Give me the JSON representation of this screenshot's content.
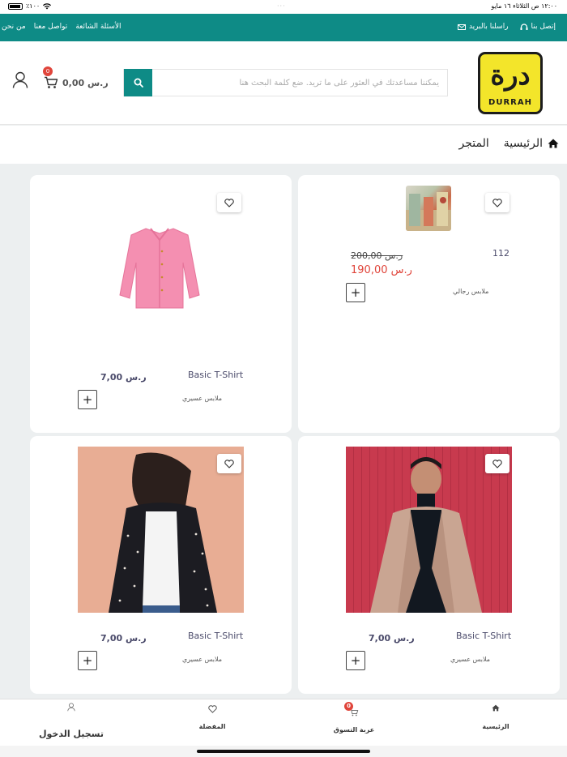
{
  "status_bar": {
    "time_date": "١٢:٠٠ ص   الثلاثاء ١٦ مايو",
    "battery": "٪١٠٠"
  },
  "top_bar": {
    "links": [
      "من نحن",
      "تواصل معنا",
      "الأسئلة الشائعة"
    ],
    "call_label": "إتصل بنا",
    "mail_label": "راسلنا بالبريد"
  },
  "header": {
    "logo_text": "درة",
    "logo_word": "DURRAH",
    "search_placeholder": "يمكننا مساعدتك في العثور على ما تريد. ضع كلمة البحث هنا",
    "cart_total": "0,00 ر.س",
    "cart_count": "0"
  },
  "breadcrumb": {
    "home": "الرئيسية",
    "current": "المتجر"
  },
  "products": [
    {
      "name": "112",
      "category": "ملابس رجالي",
      "old_price": "200,00 ر.س",
      "price": "190,00 ر.س"
    },
    {
      "name": "Basic T-Shirt",
      "category": "ملابس عسيري",
      "price": "7,00 ر.س"
    },
    {
      "name": "Basic T-Shirt",
      "category": "ملابس عسيري",
      "price": "7,00 ر.س"
    },
    {
      "name": "Basic T-Shirt",
      "category": "ملابس عسيري",
      "price": "7,00 ر.س"
    }
  ],
  "add_symbol": "+",
  "bottom_nav": {
    "home": "الرئيسية",
    "cart": "عربة التسوق",
    "cart_count": "0",
    "favorites": "المفضلة",
    "login": "تسجيل الدخول"
  },
  "colors": {
    "primary": "#0e8b86",
    "accent": "#e0453b",
    "logo_bg": "#f3e52a"
  }
}
